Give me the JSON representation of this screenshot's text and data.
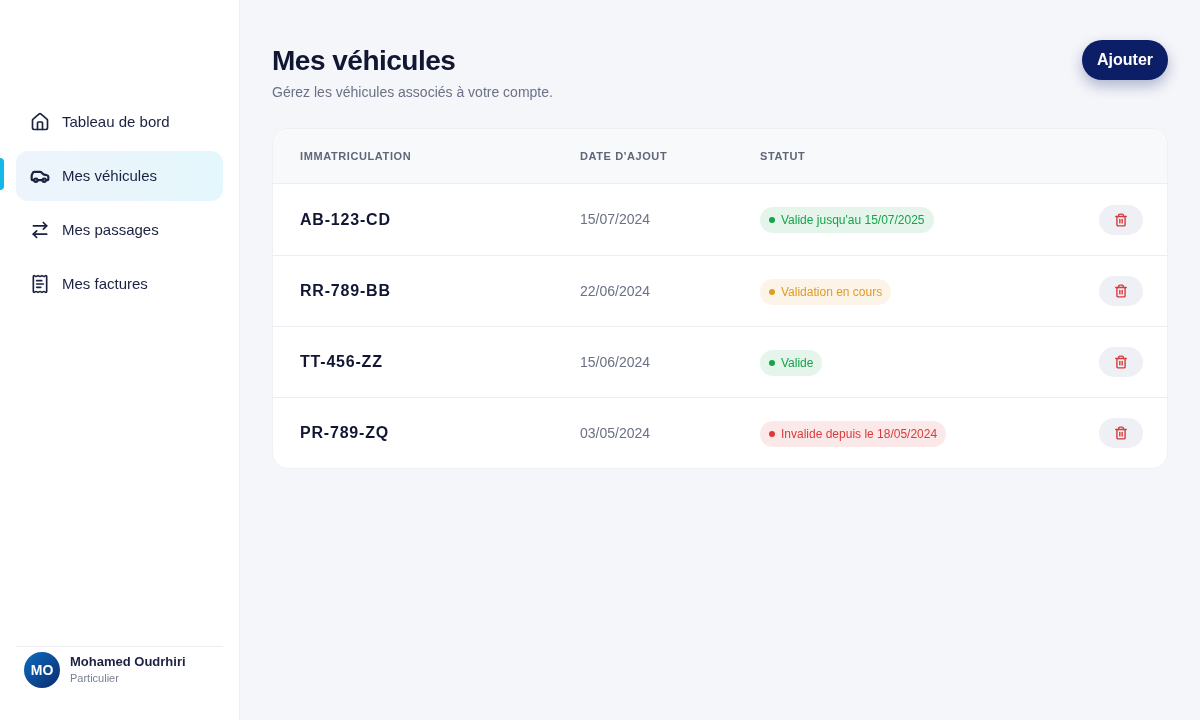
{
  "sidebar": {
    "nav_items": [
      {
        "label": "Tableau de bord",
        "selected": false
      },
      {
        "label": "Mes véhicules",
        "selected": true
      },
      {
        "label": "Mes passages",
        "selected": false
      },
      {
        "label": "Mes factures",
        "selected": false
      }
    ],
    "user": {
      "initials": "MO",
      "name": "Mohamed Oudrhiri",
      "role": "Particulier"
    }
  },
  "header": {
    "title": "Mes véhicules",
    "subtitle": "Gérez les véhicules associés à votre compte.",
    "add_button": "Ajouter"
  },
  "table": {
    "columns": [
      "IMMATRICULATION",
      "DATE D'AJOUT",
      "STATUT"
    ],
    "rows": [
      {
        "plate": "AB-123-CD",
        "date": "15/07/2024",
        "status": {
          "text": "Valide jusqu'au 15/07/2025",
          "color": "#16a34a"
        }
      },
      {
        "plate": "RR-789-BB",
        "date": "22/06/2024",
        "status": {
          "text": "Validation en cours",
          "color": "#e29a27"
        }
      },
      {
        "plate": "TT-456-ZZ",
        "date": "15/06/2024",
        "status": {
          "text": "Valide",
          "color": "#16a34a"
        }
      },
      {
        "plate": "PR-789-ZQ",
        "date": "03/05/2024",
        "status": {
          "text": "Invalide depuis le 18/05/2024",
          "color": "#dc3a3a"
        }
      }
    ]
  }
}
